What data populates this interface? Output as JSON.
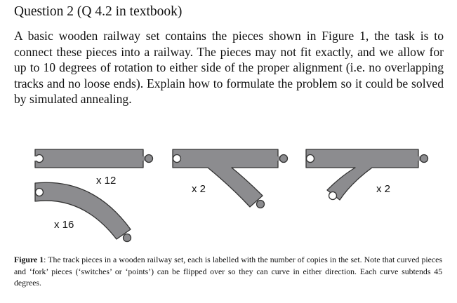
{
  "heading": "Question 2 (Q 4.2 in textbook)",
  "paragraph": "A basic wooden railway set contains the pieces shown in Figure 1, the task is to connect these pieces into a railway. The pieces may not fit exactly, and we allow for up to 10 degrees of rotation to either side of the proper alignment (i.e. no overlapping tracks and no loose ends). Explain how to formulate the problem so it could be solved by simulated annealing.",
  "figure": {
    "pieces": [
      {
        "name": "straight",
        "count": "x 12"
      },
      {
        "name": "fork-right",
        "count": "x 2"
      },
      {
        "name": "fork-left",
        "count": "x 2"
      },
      {
        "name": "curve",
        "count": "x 16"
      }
    ],
    "track_color": "#8c8c8f",
    "caption_label": "Figure 1",
    "caption_text": ": The track pieces in a wooden railway set, each is labelled with the number of copies in the set. Note that curved pieces and ‘fork’ pieces (‘switches’ or ‘points’) can be flipped over so they can curve in either direction. Each curve subtends 45 degrees."
  }
}
